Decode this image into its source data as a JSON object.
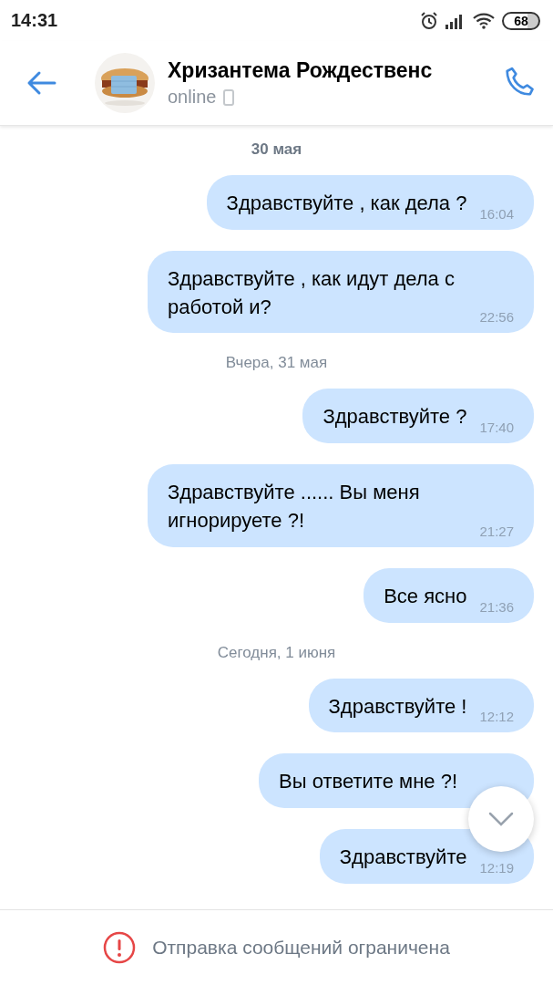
{
  "status_bar": {
    "time": "14:31",
    "battery": "68"
  },
  "header": {
    "name": "Хризантема Рождественс",
    "status": "online"
  },
  "messages": [
    {
      "kind": "date",
      "text": "30 мая"
    },
    {
      "kind": "message",
      "text": "Здравствуйте , как дела ?",
      "time": "16:04"
    },
    {
      "kind": "message",
      "text": "Здравствуйте , как идут дела с работой и?",
      "time": "22:56"
    },
    {
      "kind": "date",
      "text": "Вчера, 31 мая"
    },
    {
      "kind": "message",
      "text": "Здравствуйте ?",
      "time": "17:40"
    },
    {
      "kind": "message",
      "text": "Здравствуйте ...... Вы меня игнорируете ?!",
      "time": "21:27"
    },
    {
      "kind": "message",
      "text": "Все ясно",
      "time": "21:36"
    },
    {
      "kind": "date",
      "text": "Сегодня, 1 июня"
    },
    {
      "kind": "message",
      "text": "Здравствуйте !",
      "time": "12:12"
    },
    {
      "kind": "message",
      "text": "Вы ответите мне ?!"
    },
    {
      "kind": "message",
      "text": "Здравствуйте",
      "time": "12:19"
    }
  ],
  "footer": {
    "notice": "Отправка сообщений ограничена"
  }
}
